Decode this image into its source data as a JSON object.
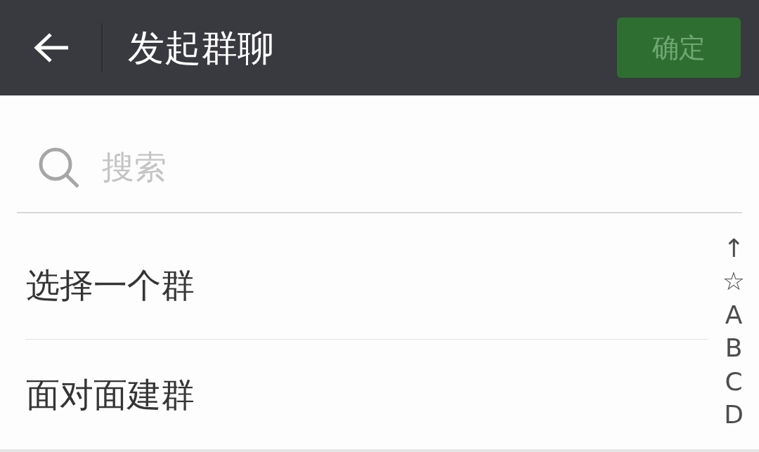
{
  "header": {
    "title": "发起群聊",
    "confirm_button": {
      "label": "确定",
      "disabled": true
    }
  },
  "search": {
    "placeholder": "搜索"
  },
  "menu_items": [
    {
      "label": "选择一个群"
    },
    {
      "label": "面对面建群"
    }
  ],
  "index_bar": [
    "↑",
    "☆",
    "A",
    "B",
    "C",
    "D"
  ]
}
